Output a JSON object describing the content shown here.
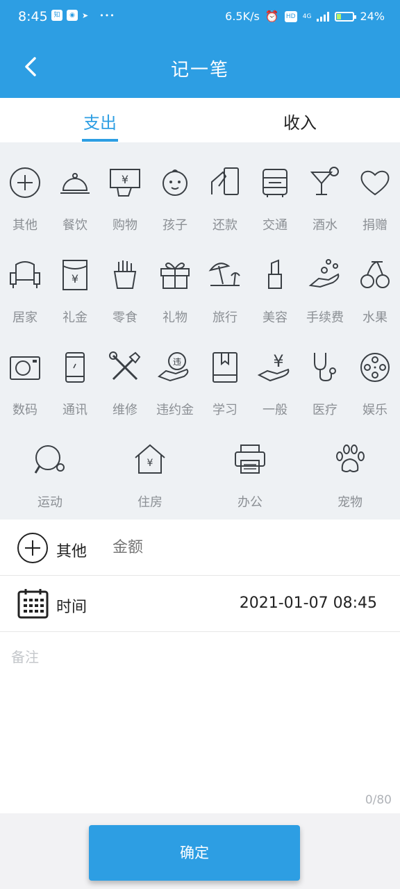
{
  "status_bar": {
    "time": "8:45",
    "network_speed": "6.5K/s",
    "hd_label": "HD",
    "net_type": "4G",
    "battery": "24%"
  },
  "header": {
    "title": "记一笔"
  },
  "tabs": [
    {
      "label": "支出",
      "active": true
    },
    {
      "label": "收入",
      "active": false
    }
  ],
  "categories": [
    {
      "label": "其他",
      "icon": "plus-circle-icon"
    },
    {
      "label": "餐饮",
      "icon": "cloche-icon"
    },
    {
      "label": "购物",
      "icon": "shopping-icon"
    },
    {
      "label": "孩子",
      "icon": "baby-icon"
    },
    {
      "label": "还款",
      "icon": "repay-icon"
    },
    {
      "label": "交通",
      "icon": "bus-icon"
    },
    {
      "label": "酒水",
      "icon": "cocktail-icon"
    },
    {
      "label": "捐赠",
      "icon": "heart-icon"
    },
    {
      "label": "居家",
      "icon": "armchair-icon"
    },
    {
      "label": "礼金",
      "icon": "red-envelope-icon"
    },
    {
      "label": "零食",
      "icon": "fries-icon"
    },
    {
      "label": "礼物",
      "icon": "gift-icon"
    },
    {
      "label": "旅行",
      "icon": "beach-icon"
    },
    {
      "label": "美容",
      "icon": "lipstick-icon"
    },
    {
      "label": "手续费",
      "icon": "coins-hand-icon"
    },
    {
      "label": "水果",
      "icon": "cherry-icon"
    },
    {
      "label": "数码",
      "icon": "camera-icon"
    },
    {
      "label": "通讯",
      "icon": "phone-icon"
    },
    {
      "label": "维修",
      "icon": "tools-icon"
    },
    {
      "label": "违约金",
      "icon": "penalty-icon"
    },
    {
      "label": "学习",
      "icon": "book-icon"
    },
    {
      "label": "一般",
      "icon": "yen-hand-icon"
    },
    {
      "label": "医疗",
      "icon": "stethoscope-icon"
    },
    {
      "label": "娱乐",
      "icon": "film-reel-icon"
    },
    {
      "label": "运动",
      "icon": "pingpong-icon"
    },
    {
      "label": "住房",
      "icon": "house-icon"
    },
    {
      "label": "办公",
      "icon": "printer-icon"
    },
    {
      "label": "宠物",
      "icon": "paw-icon"
    }
  ],
  "amount_row": {
    "category": "其他",
    "placeholder": "金额"
  },
  "time_row": {
    "label": "时间",
    "value": "2021-01-07 08:45"
  },
  "note": {
    "placeholder": "备注",
    "counter": "0/80"
  },
  "confirm_label": "确定",
  "colors": {
    "primary": "#2d9ee3",
    "icon_stroke": "#3a3f44",
    "label_gray": "#8b8f94"
  }
}
